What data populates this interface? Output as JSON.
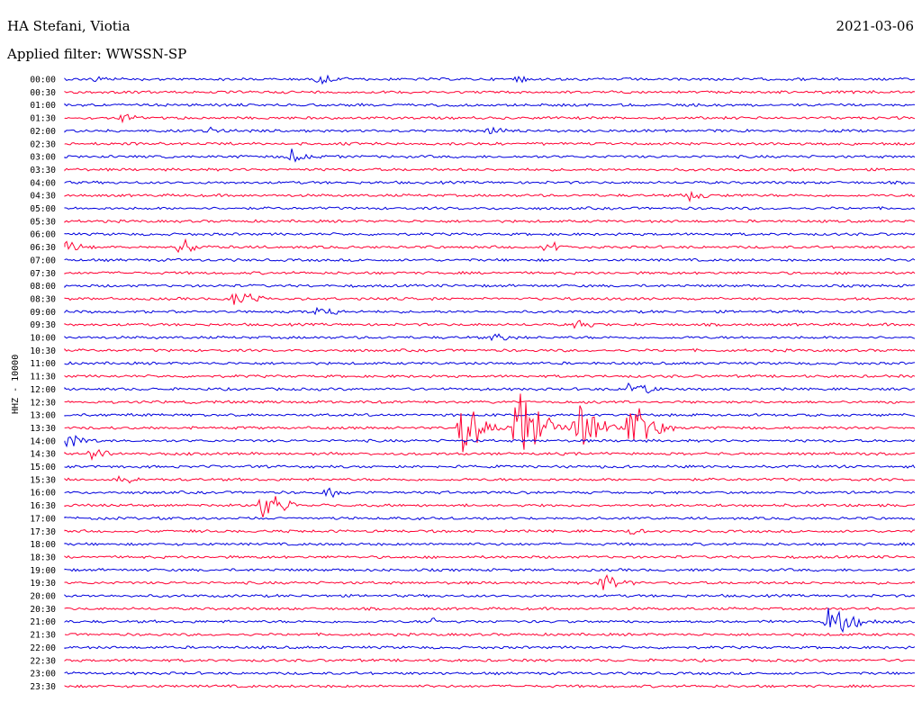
{
  "header": {
    "station": "HA Stefani, Viotia",
    "filter": "Applied filter: WWSSN-SP",
    "date": "2021-03-06",
    "channel": "HHZ - 10000"
  },
  "colors": {
    "even_trace": "#0000dd",
    "odd_trace": "#ff0033"
  },
  "chart_data": {
    "type": "line",
    "title": "HA Stefani, Viotia",
    "subtitle": "Applied filter: WWSSN-SP",
    "ylabel": "HHZ - 10000",
    "row_labels": [
      "00:00",
      "00:30",
      "01:00",
      "01:30",
      "02:00",
      "02:30",
      "03:00",
      "03:30",
      "04:00",
      "04:30",
      "05:00",
      "05:30",
      "06:00",
      "06:30",
      "07:00",
      "07:30",
      "08:00",
      "08:30",
      "09:00",
      "09:30",
      "10:00",
      "10:30",
      "11:00",
      "11:30",
      "12:00",
      "12:30",
      "13:00",
      "13:30",
      "14:00",
      "14:30",
      "15:00",
      "15:30",
      "16:00",
      "16:30",
      "17:00",
      "17:30",
      "18:00",
      "18:30",
      "19:00",
      "19:30",
      "20:00",
      "20:30",
      "21:00",
      "21:30",
      "22:00",
      "22:30",
      "23:00",
      "23:30"
    ],
    "row_minutes": 30,
    "events": [
      {
        "row": "00:00",
        "minute": 1,
        "amplitude": 6
      },
      {
        "row": "00:00",
        "minute": 9,
        "amplitude": 10
      },
      {
        "row": "00:00",
        "minute": 16,
        "amplitude": 5
      },
      {
        "row": "01:30",
        "minute": 2,
        "amplitude": 7
      },
      {
        "row": "02:00",
        "minute": 5,
        "amplitude": 6
      },
      {
        "row": "02:00",
        "minute": 15,
        "amplitude": 7
      },
      {
        "row": "03:00",
        "minute": 8,
        "amplitude": 10
      },
      {
        "row": "04:30",
        "minute": 22,
        "amplitude": 9
      },
      {
        "row": "06:30",
        "minute": 0,
        "amplitude": 10
      },
      {
        "row": "06:30",
        "minute": 4,
        "amplitude": 14
      },
      {
        "row": "06:30",
        "minute": 17,
        "amplitude": 10
      },
      {
        "row": "08:30",
        "minute": 6,
        "amplitude": 16
      },
      {
        "row": "09:00",
        "minute": 9,
        "amplitude": 10
      },
      {
        "row": "09:30",
        "minute": 18,
        "amplitude": 8
      },
      {
        "row": "10:00",
        "minute": 15,
        "amplitude": 9
      },
      {
        "row": "12:00",
        "minute": 20,
        "amplitude": 14
      },
      {
        "row": "13:30",
        "minute": 14,
        "amplitude": 45
      },
      {
        "row": "13:30",
        "minute": 16,
        "amplitude": 70
      },
      {
        "row": "13:30",
        "minute": 18,
        "amplitude": 50
      },
      {
        "row": "13:30",
        "minute": 20,
        "amplitude": 40
      },
      {
        "row": "14:00",
        "minute": 0,
        "amplitude": 12
      },
      {
        "row": "14:30",
        "minute": 1,
        "amplitude": 12
      },
      {
        "row": "15:30",
        "minute": 2,
        "amplitude": 8
      },
      {
        "row": "16:00",
        "minute": 9,
        "amplitude": 12
      },
      {
        "row": "16:30",
        "minute": 7,
        "amplitude": 24
      },
      {
        "row": "17:30",
        "minute": 20,
        "amplitude": 7
      },
      {
        "row": "19:30",
        "minute": 19,
        "amplitude": 18
      },
      {
        "row": "21:00",
        "minute": 27,
        "amplitude": 30
      },
      {
        "row": "21:00",
        "minute": 13,
        "amplitude": 5
      }
    ]
  }
}
